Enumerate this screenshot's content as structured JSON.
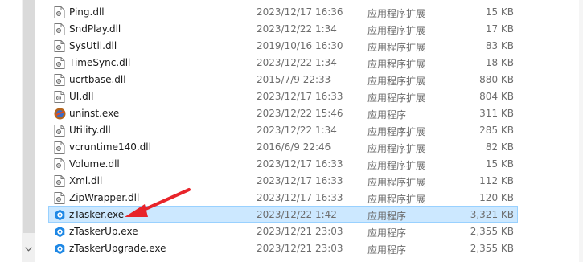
{
  "files": [
    {
      "name": "Ping.dll",
      "date": "2023/12/17 16:36",
      "type": "应用程序扩展",
      "size": "15 KB",
      "icon": "dll-file-icon"
    },
    {
      "name": "SndPlay.dll",
      "date": "2023/12/22 1:34",
      "type": "应用程序扩展",
      "size": "17 KB",
      "icon": "dll-file-icon"
    },
    {
      "name": "SysUtil.dll",
      "date": "2019/10/16 16:30",
      "type": "应用程序扩展",
      "size": "83 KB",
      "icon": "dll-file-icon"
    },
    {
      "name": "TimeSync.dll",
      "date": "2023/12/22 1:34",
      "type": "应用程序扩展",
      "size": "18 KB",
      "icon": "dll-file-icon"
    },
    {
      "name": "ucrtbase.dll",
      "date": "2015/7/9 22:33",
      "type": "应用程序扩展",
      "size": "880 KB",
      "icon": "dll-file-icon"
    },
    {
      "name": "UI.dll",
      "date": "2023/12/17 16:33",
      "type": "应用程序扩展",
      "size": "804 KB",
      "icon": "dll-file-icon"
    },
    {
      "name": "uninst.exe",
      "date": "2023/12/22 15:46",
      "type": "应用程序",
      "size": "311 KB",
      "icon": "uninstaller-icon"
    },
    {
      "name": "Utility.dll",
      "date": "2023/12/22 1:34",
      "type": "应用程序扩展",
      "size": "285 KB",
      "icon": "dll-file-icon"
    },
    {
      "name": "vcruntime140.dll",
      "date": "2016/6/9 22:46",
      "type": "应用程序扩展",
      "size": "82 KB",
      "icon": "dll-file-icon"
    },
    {
      "name": "Volume.dll",
      "date": "2023/12/17 16:33",
      "type": "应用程序扩展",
      "size": "15 KB",
      "icon": "dll-file-icon"
    },
    {
      "name": "Xml.dll",
      "date": "2023/12/17 16:33",
      "type": "应用程序扩展",
      "size": "112 KB",
      "icon": "dll-file-icon"
    },
    {
      "name": "ZipWrapper.dll",
      "date": "2023/12/17 16:33",
      "type": "应用程序扩展",
      "size": "120 KB",
      "icon": "dll-file-icon"
    },
    {
      "name": "zTasker.exe",
      "date": "2023/12/22 1:42",
      "type": "应用程序",
      "size": "3,321 KB",
      "icon": "ztasker-app-icon",
      "selected": true
    },
    {
      "name": "zTaskerUp.exe",
      "date": "2023/12/21 23:03",
      "type": "应用程序",
      "size": "2,355 KB",
      "icon": "ztasker-app-icon"
    },
    {
      "name": "zTaskerUpgrade.exe",
      "date": "2023/12/21 23:03",
      "type": "应用程序",
      "size": "2,355 KB",
      "icon": "ztasker-app-icon"
    }
  ],
  "colors": {
    "selection_bg": "#cce8ff",
    "selection_border": "#99d1ff",
    "annotation_arrow": "#e8242a",
    "app_icon_blue": "#1e88e5"
  },
  "icons": {
    "scroll_down": "chevron-down-icon"
  }
}
